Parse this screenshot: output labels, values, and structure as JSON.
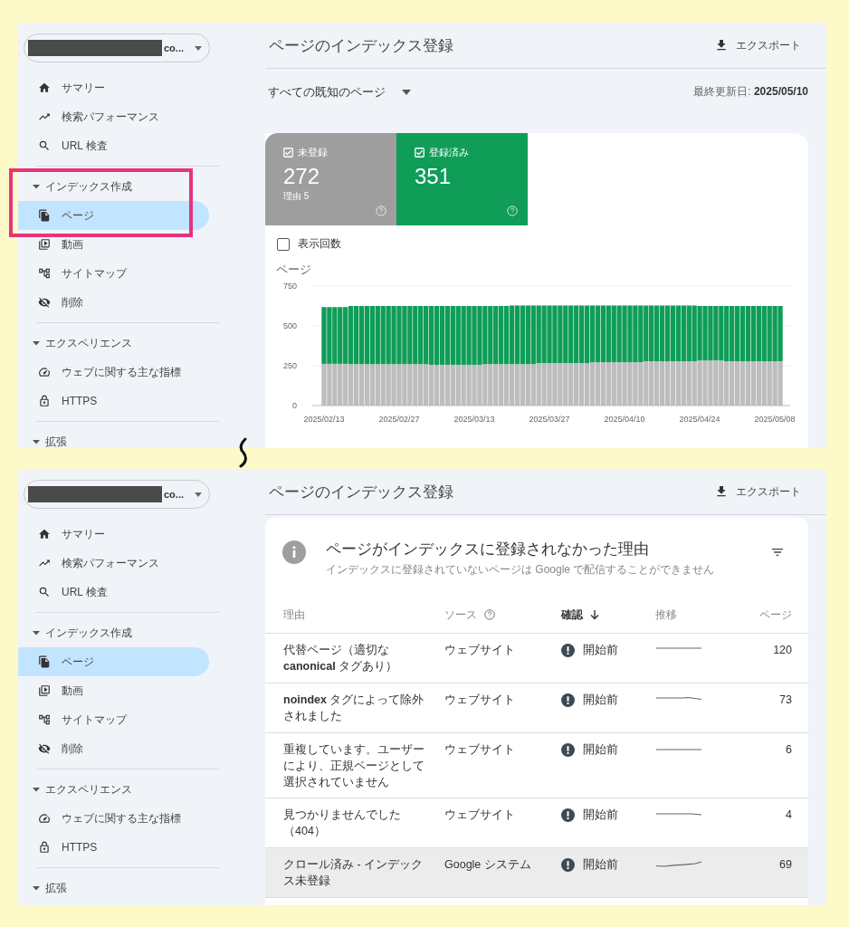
{
  "panels": [
    {
      "property": {
        "label": "co..."
      },
      "sidebar": {
        "items": [
          {
            "label": "サマリー",
            "selected": false
          },
          {
            "label": "検索パフォーマンス",
            "selected": false
          },
          {
            "label": "URL 検査",
            "selected": false
          }
        ],
        "sections": [
          {
            "label": "インデックス作成",
            "expanded": true,
            "highlighted": true,
            "items": [
              {
                "label": "ページ",
                "selected": true
              },
              {
                "label": "動画",
                "selected": false
              },
              {
                "label": "サイトマップ",
                "selected": false
              },
              {
                "label": "削除",
                "selected": false
              }
            ]
          },
          {
            "label": "エクスペリエンス",
            "expanded": true,
            "highlighted": false,
            "items": [
              {
                "label": "ウェブに関する主な指標",
                "selected": false
              },
              {
                "label": "HTTPS",
                "selected": false
              }
            ]
          },
          {
            "label": "拡張",
            "expanded": true,
            "highlighted": false
          }
        ]
      },
      "header": {
        "title": "ページのインデックス登録",
        "export": "エクスポート"
      },
      "content": {
        "kind": "overview",
        "filter": "すべての既知のページ",
        "last_updated": "最終更新日: **2025/05/10**",
        "tiles": [
          {
            "label": "未登録",
            "value": "272",
            "sub": "理由 5",
            "checked": true,
            "color": "#9e9e9e"
          },
          {
            "label": "登録済み",
            "value": "351",
            "checked": true,
            "color": "#0f9d58"
          }
        ],
        "impressions": {
          "label": "表示回数",
          "checked": false
        },
        "chart_data": {
          "type": "bar",
          "ylabel": "ページ",
          "stacked": true,
          "ylim": [
            0,
            750
          ],
          "yticks": [
            0,
            250,
            500,
            750
          ],
          "categories": [
            "2025/02/13",
            null,
            null,
            null,
            null,
            null,
            null,
            null,
            null,
            null,
            null,
            null,
            null,
            null,
            "2025/02/27",
            null,
            null,
            null,
            null,
            null,
            null,
            null,
            null,
            null,
            null,
            null,
            null,
            null,
            "2025/03/13",
            null,
            null,
            null,
            null,
            null,
            null,
            null,
            null,
            null,
            null,
            null,
            null,
            null,
            "2025/03/27",
            null,
            null,
            null,
            null,
            null,
            null,
            null,
            null,
            null,
            null,
            null,
            null,
            null,
            "2025/04/10",
            null,
            null,
            null,
            null,
            null,
            null,
            null,
            null,
            null,
            null,
            null,
            null,
            null,
            "2025/04/24",
            null,
            null,
            null,
            null,
            null,
            null,
            null,
            null,
            null,
            null,
            null,
            null,
            null,
            "2025/05/08",
            null
          ],
          "series": [
            {
              "color": "#bdbdbd",
              "values": [
                262,
                262,
                262,
                262,
                262,
                260,
                260,
                260,
                260,
                260,
                260,
                260,
                260,
                260,
                260,
                260,
                260,
                260,
                260,
                260,
                256,
                256,
                256,
                256,
                256,
                256,
                256,
                256,
                256,
                256,
                260,
                260,
                260,
                260,
                260,
                260,
                260,
                260,
                260,
                260,
                266,
                266,
                266,
                266,
                266,
                266,
                266,
                266,
                266,
                266,
                272,
                272,
                272,
                272,
                272,
                272,
                272,
                272,
                272,
                272,
                278,
                278,
                278,
                278,
                278,
                278,
                278,
                278,
                278,
                278,
                283,
                283,
                283,
                283,
                283,
                278,
                278,
                278,
                278,
                278,
                278,
                278,
                278,
                278,
                278,
                278
              ]
            },
            {
              "color": "#0f9d58",
              "values": [
                356,
                356,
                356,
                356,
                356,
                365,
                365,
                365,
                365,
                365,
                365,
                365,
                365,
                365,
                365,
                365,
                365,
                365,
                365,
                365,
                369,
                369,
                369,
                369,
                369,
                369,
                369,
                369,
                369,
                369,
                365,
                365,
                365,
                365,
                365,
                368,
                368,
                368,
                368,
                368,
                362,
                362,
                362,
                362,
                362,
                362,
                362,
                362,
                362,
                362,
                356,
                356,
                356,
                356,
                356,
                356,
                356,
                356,
                356,
                356,
                350,
                350,
                350,
                350,
                350,
                350,
                350,
                350,
                350,
                350,
                342,
                342,
                342,
                342,
                342,
                347,
                347,
                347,
                347,
                347,
                347,
                347,
                347,
                347,
                347,
                347
              ]
            }
          ]
        }
      }
    },
    {
      "property": {
        "label": "co..."
      },
      "sidebar": {
        "items": [
          {
            "label": "サマリー",
            "selected": false
          },
          {
            "label": "検索パフォーマンス",
            "selected": false
          },
          {
            "label": "URL 検査",
            "selected": false
          }
        ],
        "sections": [
          {
            "label": "インデックス作成",
            "expanded": true,
            "highlighted": false,
            "items": [
              {
                "label": "ページ",
                "selected": true
              },
              {
                "label": "動画",
                "selected": false
              },
              {
                "label": "サイトマップ",
                "selected": false
              },
              {
                "label": "削除",
                "selected": false
              }
            ]
          },
          {
            "label": "エクスペリエンス",
            "expanded": true,
            "highlighted": false,
            "items": [
              {
                "label": "ウェブに関する主な指標",
                "selected": false
              },
              {
                "label": "HTTPS",
                "selected": false
              }
            ]
          },
          {
            "label": "拡張",
            "expanded": true,
            "highlighted": false
          }
        ]
      },
      "header": {
        "title": "ページのインデックス登録",
        "export": "エクスポート"
      },
      "content": {
        "kind": "table",
        "title": "ページがインデックスに登録されなかった理由",
        "subtitle": "インデックスに登録されていないページは Google で配信することができません",
        "columns": [
          {
            "label": "理由",
            "help": false,
            "sorted": false
          },
          {
            "label": "ソース",
            "help": true,
            "sorted": false
          },
          {
            "label": "確認",
            "help": false,
            "sorted": true
          },
          {
            "label": "推移",
            "help": false,
            "sorted": false
          },
          {
            "label": "ページ",
            "help": false,
            "sorted": false
          }
        ],
        "rows": [
          {
            "reason": "代替ページ（適切な **canonical** タグあり）",
            "source": "ウェブサイト",
            "status": "開始前",
            "pages": "120",
            "highlighted": false
          },
          {
            "reason": "**noindex** タグによって除外されました",
            "source": "ウェブサイト",
            "status": "開始前",
            "pages": "73",
            "highlighted": false
          },
          {
            "reason": "重複しています。ユーザーにより、正規ページとして選択されていません",
            "source": "ウェブサイト",
            "status": "開始前",
            "pages": "6",
            "highlighted": false
          },
          {
            "reason": "見つかりませんでした（404）",
            "source": "ウェブサイト",
            "status": "開始前",
            "pages": "4",
            "highlighted": false
          },
          {
            "reason": "クロール済み - インデックス未登録",
            "source": "Google システム",
            "status": "開始前",
            "pages": "69",
            "highlighted": true
          }
        ]
      }
    }
  ]
}
